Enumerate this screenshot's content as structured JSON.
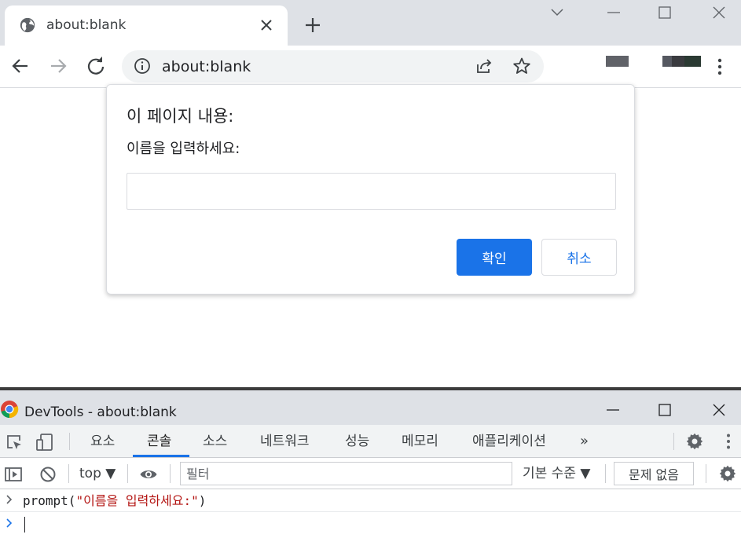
{
  "browser": {
    "tab": {
      "title": "about:blank"
    },
    "omnibox": {
      "url": "about:blank"
    }
  },
  "dialog": {
    "title": "이 페이지 내용:",
    "message": "이름을 입력하세요:",
    "input_value": "",
    "ok_label": "확인",
    "cancel_label": "취소"
  },
  "devtools": {
    "window_title": "DevTools - about:blank",
    "tabs": [
      {
        "label": "요소"
      },
      {
        "label": "콘솔"
      },
      {
        "label": "소스"
      },
      {
        "label": "네트워크"
      },
      {
        "label": "성능"
      },
      {
        "label": "메모리"
      },
      {
        "label": "애플리케이션"
      }
    ],
    "active_tab": "콘솔",
    "more_tabs_label": "»",
    "console_toolbar": {
      "context": "top ▼",
      "filter_placeholder": "필터",
      "levels": "기본 수준 ▼",
      "issues_label": "문제 없음"
    },
    "console": {
      "entry_fn": "prompt(",
      "entry_arg": "\"이름을 입력하세요:\"",
      "entry_close": ")"
    }
  },
  "colors": {
    "accent": "#1a73e8",
    "tabstrip": "#dee1e6",
    "console_string": "#b31412"
  },
  "icons": {
    "tab_favicon": "globe-icon",
    "tab_close": "close-icon",
    "new_tab": "plus-icon",
    "back": "arrow-left-icon",
    "forward": "arrow-right-icon",
    "reload": "reload-icon",
    "site_info": "info-icon",
    "share": "share-icon",
    "bookmark": "star-icon",
    "menu": "kebab-icon",
    "devtools_logo": "chrome-logo-icon",
    "inspect": "inspect-element-icon",
    "device": "device-toggle-icon",
    "sidebar": "sidebar-toggle-icon",
    "clear": "clear-console-icon",
    "eye": "eye-icon",
    "settings": "gear-icon"
  }
}
